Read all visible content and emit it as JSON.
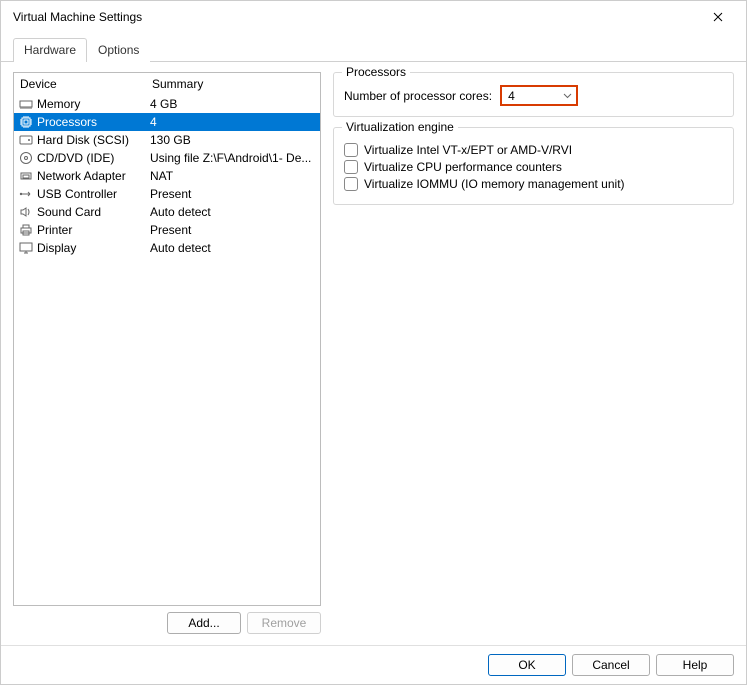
{
  "title": "Virtual Machine Settings",
  "tabs": {
    "hardware": "Hardware",
    "options": "Options"
  },
  "columns": {
    "device": "Device",
    "summary": "Summary"
  },
  "devices": [
    {
      "name": "Memory",
      "summary": "4 GB",
      "icon": "memory"
    },
    {
      "name": "Processors",
      "summary": "4",
      "icon": "cpu",
      "selected": true
    },
    {
      "name": "Hard Disk (SCSI)",
      "summary": "130 GB",
      "icon": "hdd"
    },
    {
      "name": "CD/DVD (IDE)",
      "summary": "Using file Z:\\F\\Android\\1- De...",
      "icon": "cd"
    },
    {
      "name": "Network Adapter",
      "summary": "NAT",
      "icon": "net"
    },
    {
      "name": "USB Controller",
      "summary": "Present",
      "icon": "usb"
    },
    {
      "name": "Sound Card",
      "summary": "Auto detect",
      "icon": "sound"
    },
    {
      "name": "Printer",
      "summary": "Present",
      "icon": "printer"
    },
    {
      "name": "Display",
      "summary": "Auto detect",
      "icon": "display"
    }
  ],
  "leftButtons": {
    "add": "Add...",
    "remove": "Remove"
  },
  "processors": {
    "legend": "Processors",
    "coresLabel": "Number of processor cores:",
    "coresValue": "4"
  },
  "virtEngine": {
    "legend": "Virtualization engine",
    "opt1": "Virtualize Intel VT-x/EPT or AMD-V/RVI",
    "opt2": "Virtualize CPU performance counters",
    "opt3": "Virtualize IOMMU (IO memory management unit)"
  },
  "footer": {
    "ok": "OK",
    "cancel": "Cancel",
    "help": "Help"
  }
}
